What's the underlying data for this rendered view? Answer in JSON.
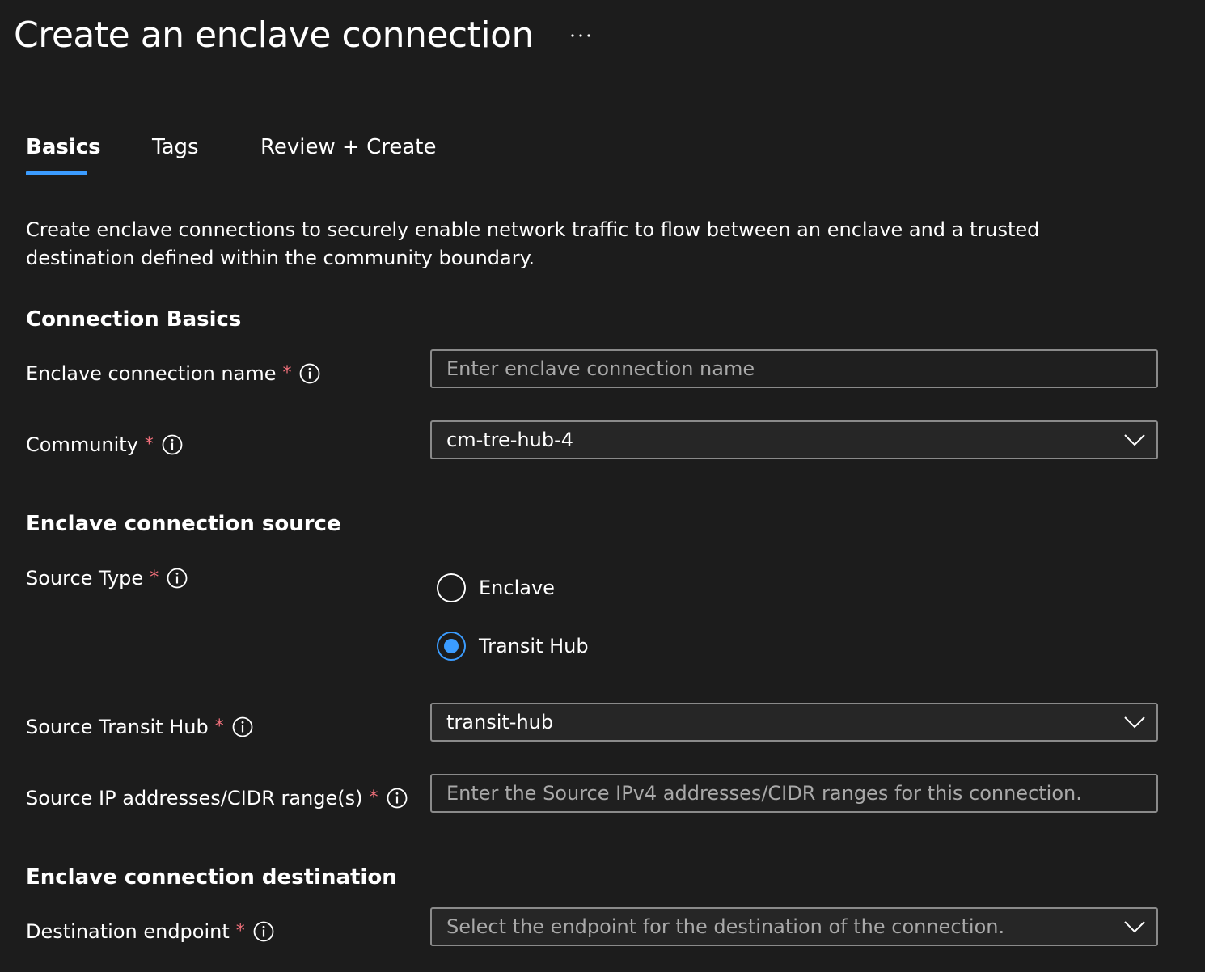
{
  "page": {
    "title": "Create an enclave connection",
    "more_label": "More options"
  },
  "tabs": [
    {
      "label": "Basics",
      "active": true
    },
    {
      "label": "Tags",
      "active": false
    },
    {
      "label": "Review + Create",
      "active": false
    }
  ],
  "description": "Create enclave connections to securely enable network traffic to flow between an enclave and a trusted destination defined within the community boundary.",
  "sections": {
    "connection_basics": "Connection Basics",
    "source": "Enclave connection source",
    "destination": "Enclave connection destination"
  },
  "required_marker": "*",
  "fields": {
    "name": {
      "label": "Enclave connection name",
      "placeholder": "Enter enclave connection name",
      "value": ""
    },
    "community": {
      "label": "Community",
      "value": "cm-tre-hub-4"
    },
    "source_type": {
      "label": "Source Type",
      "options": [
        {
          "label": "Enclave",
          "selected": false
        },
        {
          "label": "Transit Hub",
          "selected": true
        }
      ]
    },
    "source_transit_hub": {
      "label": "Source Transit Hub",
      "value": "transit-hub"
    },
    "source_ip": {
      "label": "Source IP addresses/CIDR range(s)",
      "placeholder": "Enter the Source IPv4 addresses/CIDR ranges for this connection.",
      "value": ""
    },
    "destination_endpoint": {
      "label": "Destination endpoint",
      "placeholder": "Select the endpoint for the destination of the connection."
    }
  },
  "colors": {
    "background": "#1c1c1c",
    "accent": "#3b9cff",
    "required": "#f1707b",
    "border": "#8a8a8a",
    "placeholder_text": "#a9a9a9"
  },
  "icons": {
    "info": "info-circle-icon",
    "chevron": "chevron-down-icon",
    "more": "ellipsis-icon"
  }
}
